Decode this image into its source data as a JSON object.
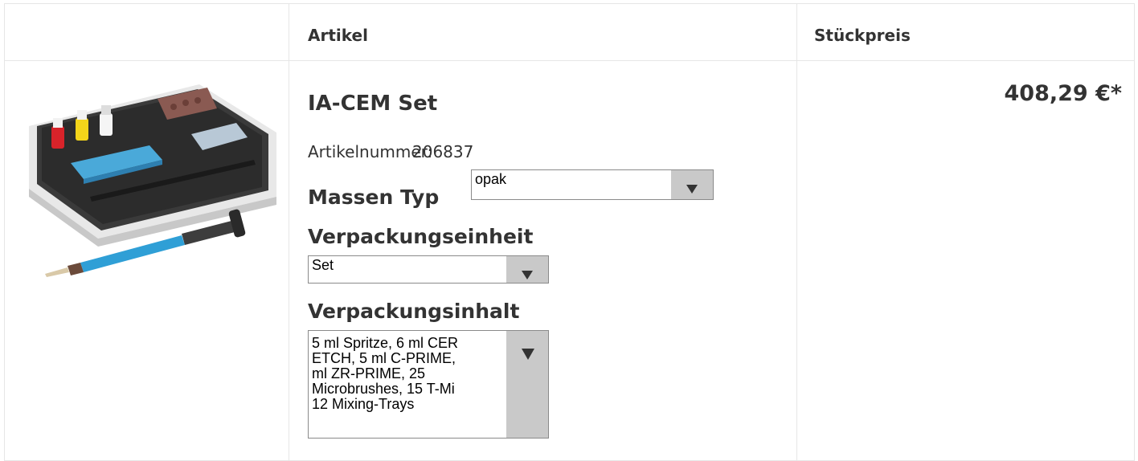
{
  "header": {
    "article_label": "Artikel",
    "price_label": "Stückpreis"
  },
  "product": {
    "name": "IA-CEM Set",
    "article_number_label": "Artikelnummer:",
    "article_number": "206837",
    "price": "408,29 €*"
  },
  "options": {
    "mass_type": {
      "label": "Massen Typ",
      "selected": "opak"
    },
    "packaging_unit": {
      "label": "Verpackungseinheit",
      "selected": "Set"
    },
    "packaging_content": {
      "label": "Verpackungsinhalt",
      "selected": "5 ml Spritze, 6 ml CER\nETCH, 5 ml C-PRIME,\nml ZR-PRIME, 25\nMicrobrushes, 15 T-Mi\n12 Mixing-Trays"
    }
  },
  "icons": {
    "dropdown": "chevron-down-icon",
    "product_image": "product-kit-image"
  },
  "colors": {
    "border": "#e6e6e6",
    "select_button": "#c9c9c9",
    "text": "#333333"
  }
}
